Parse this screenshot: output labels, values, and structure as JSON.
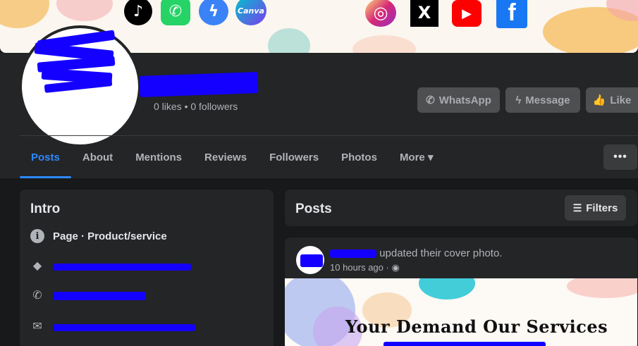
{
  "cover": {
    "social_icons": [
      {
        "name": "tiktok-icon",
        "glyph": "♪",
        "bg": "#000000",
        "fg": "#ffffff"
      },
      {
        "name": "whatsapp-icon",
        "glyph": "✆",
        "bg": "#25d366",
        "fg": "#ffffff"
      },
      {
        "name": "messenger-icon",
        "glyph": "ϟ",
        "bg": "#3b82f6",
        "fg": "#ffffff"
      },
      {
        "name": "canva-icon",
        "glyph": "Canva",
        "bg": "#7c3aed",
        "fg": "#ffffff"
      },
      {
        "name": "instagram-icon",
        "glyph": "◎",
        "bg": "#e1306c",
        "fg": "#ffffff"
      },
      {
        "name": "x-icon",
        "glyph": "𝕏",
        "bg": "#000000",
        "fg": "#ffffff"
      },
      {
        "name": "youtube-icon",
        "glyph": "▶",
        "bg": "#ff0000",
        "fg": "#ffffff"
      },
      {
        "name": "facebook-icon",
        "glyph": "f",
        "bg": "#1877f2",
        "fg": "#ffffff"
      }
    ]
  },
  "profile": {
    "stats": "0 likes • 0 followers"
  },
  "actions": {
    "whatsapp_label": "WhatsApp",
    "message_label": "Message",
    "like_label": "Like"
  },
  "tabs": [
    {
      "label": "Posts",
      "active": true
    },
    {
      "label": "About"
    },
    {
      "label": "Mentions"
    },
    {
      "label": "Reviews"
    },
    {
      "label": "Followers"
    },
    {
      "label": "Photos"
    },
    {
      "label": "More ▾"
    }
  ],
  "more_menu_label": "•••",
  "intro": {
    "title": "Intro",
    "category": "Page · Product/service"
  },
  "posts": {
    "title": "Posts",
    "filters_label": "Filters",
    "item": {
      "action_text": "updated their cover photo.",
      "time": "10 hours ago ·",
      "banner_text": "Your Demand Our Services"
    }
  },
  "colors": {
    "accent": "#2d88ff",
    "background": "#18191a",
    "card": "#242526",
    "redaction": "#1400ff"
  }
}
